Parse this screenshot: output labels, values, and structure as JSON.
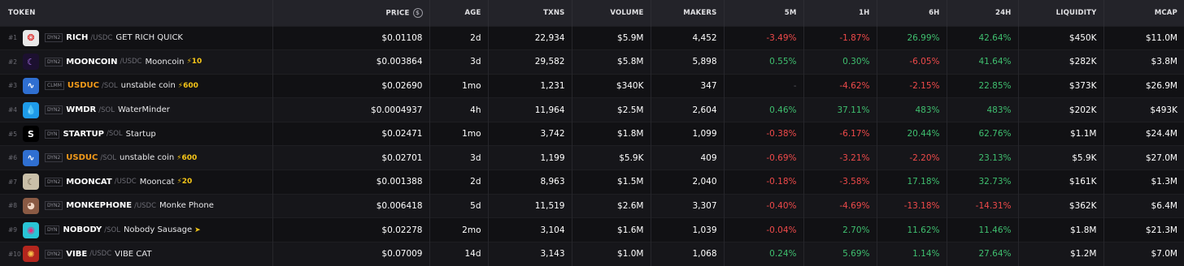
{
  "headers": {
    "token": "TOKEN",
    "price": "PRICE",
    "price_icon": "$",
    "age": "AGE",
    "txns": "TXNS",
    "volume": "VOLUME",
    "makers": "MAKERS",
    "m5": "5M",
    "h1": "1H",
    "h6": "6H",
    "h24": "24H",
    "liquidity": "LIQUIDITY",
    "mcap": "MCAP"
  },
  "colors": {
    "green": "#3fbf6f",
    "red": "#ef4a4a",
    "orange": "#f29a1a",
    "boost": "#f5c518"
  },
  "rows": [
    {
      "rank": "#1",
      "logo_icon": "rich-logo-icon",
      "dex": "DYN2",
      "symbol": "RICH",
      "quote": "/USDC",
      "name": "GET RICH QUICK",
      "boost": "",
      "price": "$0.01108",
      "age": "2d",
      "txns": "22,934",
      "volume": "$5.9M",
      "makers": "4,452",
      "m5": "-3.49%",
      "h1": "-1.87%",
      "h6": "26.99%",
      "h24": "42.64%",
      "liquidity": "$450K",
      "mcap": "$11.0M"
    },
    {
      "rank": "#2",
      "logo_icon": "mooncoin-logo-icon",
      "dex": "DYN2",
      "symbol": "MOONCOIN",
      "quote": "/USDC",
      "name": "Mooncoin",
      "boost": "⚡10",
      "price": "$0.003864",
      "age": "3d",
      "txns": "29,582",
      "volume": "$5.8M",
      "makers": "5,898",
      "m5": "0.55%",
      "h1": "0.30%",
      "h6": "-6.05%",
      "h24": "41.64%",
      "liquidity": "$282K",
      "mcap": "$3.8M"
    },
    {
      "rank": "#3",
      "logo_icon": "usduc-logo-icon",
      "dex": "CLMM",
      "symbol": "USDUC",
      "quote": "/SOL",
      "name": "unstable coin",
      "boost": "⚡600",
      "price": "$0.02690",
      "age": "1mo",
      "txns": "1,231",
      "volume": "$340K",
      "makers": "347",
      "m5": "-",
      "h1": "-4.62%",
      "h6": "-2.15%",
      "h24": "22.85%",
      "liquidity": "$373K",
      "mcap": "$26.9M"
    },
    {
      "rank": "#4",
      "logo_icon": "water-drop-logo-icon",
      "dex": "DYN2",
      "symbol": "WMDR",
      "quote": "/SOL",
      "name": "WaterMinder",
      "boost": "",
      "price": "$0.0004937",
      "age": "4h",
      "txns": "11,964",
      "volume": "$2.5M",
      "makers": "2,604",
      "m5": "0.46%",
      "h1": "37.11%",
      "h6": "483%",
      "h24": "483%",
      "liquidity": "$202K",
      "mcap": "$493K"
    },
    {
      "rank": "#5",
      "logo_icon": "startup-logo-icon",
      "dex": "DYN",
      "symbol": "STARTUP",
      "quote": "/SOL",
      "name": "Startup",
      "boost": "",
      "price": "$0.02471",
      "age": "1mo",
      "txns": "3,742",
      "volume": "$1.8M",
      "makers": "1,099",
      "m5": "-0.38%",
      "h1": "-6.17%",
      "h6": "20.44%",
      "h24": "62.76%",
      "liquidity": "$1.1M",
      "mcap": "$24.4M"
    },
    {
      "rank": "#6",
      "logo_icon": "usduc-logo-icon",
      "dex": "DYN2",
      "symbol": "USDUC",
      "quote": "/SOL",
      "name": "unstable coin",
      "boost": "⚡600",
      "price": "$0.02701",
      "age": "3d",
      "txns": "1,199",
      "volume": "$5.9K",
      "makers": "409",
      "m5": "-0.69%",
      "h1": "-3.21%",
      "h6": "-2.20%",
      "h24": "23.13%",
      "liquidity": "$5.9K",
      "mcap": "$27.0M"
    },
    {
      "rank": "#7",
      "logo_icon": "mooncat-logo-icon",
      "dex": "DYN2",
      "symbol": "MOONCAT",
      "quote": "/USDC",
      "name": "Mooncat",
      "boost": "⚡20",
      "price": "$0.001388",
      "age": "2d",
      "txns": "8,963",
      "volume": "$1.5M",
      "makers": "2,040",
      "m5": "-0.18%",
      "h1": "-3.58%",
      "h6": "17.18%",
      "h24": "32.73%",
      "liquidity": "$161K",
      "mcap": "$1.3M"
    },
    {
      "rank": "#8",
      "logo_icon": "monkephone-logo-icon",
      "dex": "DYN2",
      "symbol": "MONKEPHONE",
      "quote": "/USDC",
      "name": "Monke Phone",
      "boost": "",
      "price": "$0.006418",
      "age": "5d",
      "txns": "11,519",
      "volume": "$2.6M",
      "makers": "3,307",
      "m5": "-0.40%",
      "h1": "-4.69%",
      "h6": "-13.18%",
      "h24": "-14.31%",
      "liquidity": "$362K",
      "mcap": "$6.4M"
    },
    {
      "rank": "#9",
      "logo_icon": "nobody-logo-icon",
      "dex": "DYN",
      "symbol": "NOBODY",
      "quote": "/SOL",
      "name": "Nobody Sausage",
      "boost": "➤",
      "price": "$0.02278",
      "age": "2mo",
      "txns": "3,104",
      "volume": "$1.6M",
      "makers": "1,039",
      "m5": "-0.04%",
      "h1": "2.70%",
      "h6": "11.62%",
      "h24": "11.46%",
      "liquidity": "$1.8M",
      "mcap": "$21.3M"
    },
    {
      "rank": "#10",
      "logo_icon": "vibe-logo-icon",
      "dex": "DYN2",
      "symbol": "VIBE",
      "quote": "/USDC",
      "name": "VIBE CAT",
      "boost": "",
      "price": "$0.07009",
      "age": "14d",
      "txns": "3,143",
      "volume": "$1.0M",
      "makers": "1,068",
      "m5": "0.24%",
      "h1": "5.69%",
      "h6": "1.14%",
      "h24": "27.64%",
      "liquidity": "$1.2M",
      "mcap": "$7.0M"
    }
  ]
}
